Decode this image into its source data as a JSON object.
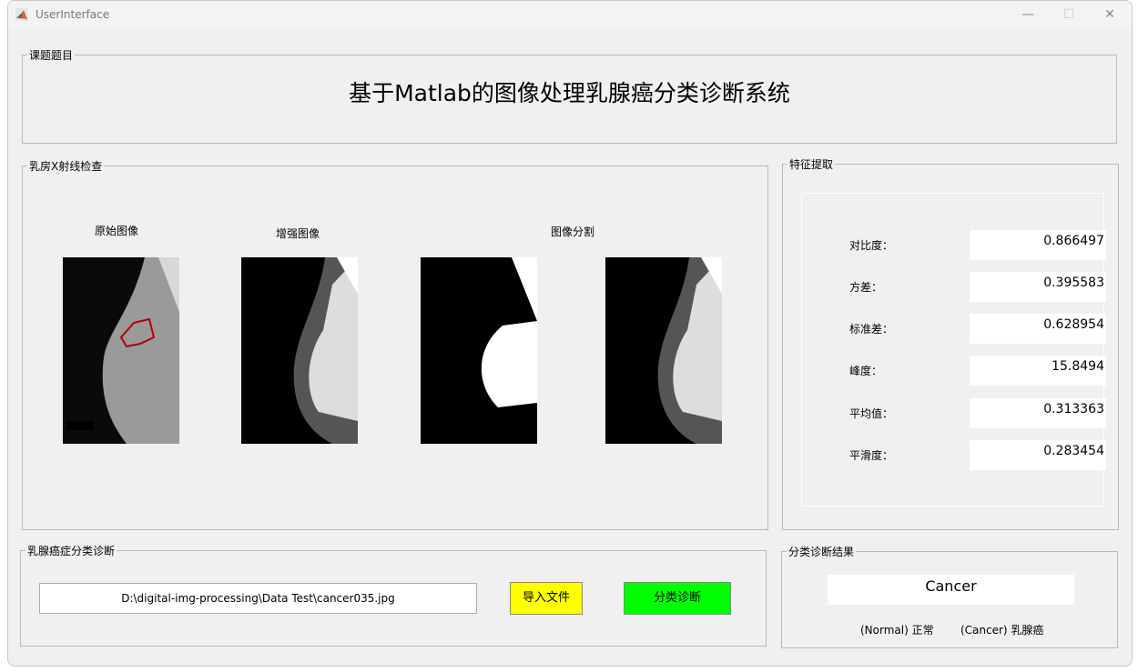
{
  "window": {
    "title": "UserInterface",
    "minimize": "—",
    "maximize": "☐",
    "close": "✕"
  },
  "title_panel": {
    "label": "课题题目",
    "title": "基于Matlab的图像处理乳腺癌分类诊断系统"
  },
  "xray_panel": {
    "label": "乳房X射线检查",
    "captions": {
      "original": "原始图像",
      "enhanced": "增强图像",
      "segmented": "图像分割"
    }
  },
  "features": {
    "label": "特征提取",
    "items": [
      {
        "label": "对比度：",
        "value": "0.866497"
      },
      {
        "label": "方差：",
        "value": "0.395583"
      },
      {
        "label": "标准差：",
        "value": "0.628954"
      },
      {
        "label": "峰度：",
        "value": "15.8494"
      },
      {
        "label": "平均值：",
        "value": "0.313363"
      },
      {
        "label": "平滑度：",
        "value": "0.283454"
      }
    ]
  },
  "diagnosis_panel": {
    "label": "乳腺癌症分类诊断",
    "file_path": "D:\\digital-img-processing\\Data Test\\cancer035.jpg",
    "import_label": "导入文件",
    "classify_label": "分类诊断",
    "import_color": "#ffff00",
    "classify_color": "#00ff00"
  },
  "result_panel": {
    "label": "分类诊断结果",
    "result": "Cancer",
    "legend_normal": "(Normal) 正常",
    "legend_cancer": "(Cancer) 乳腺癌"
  }
}
